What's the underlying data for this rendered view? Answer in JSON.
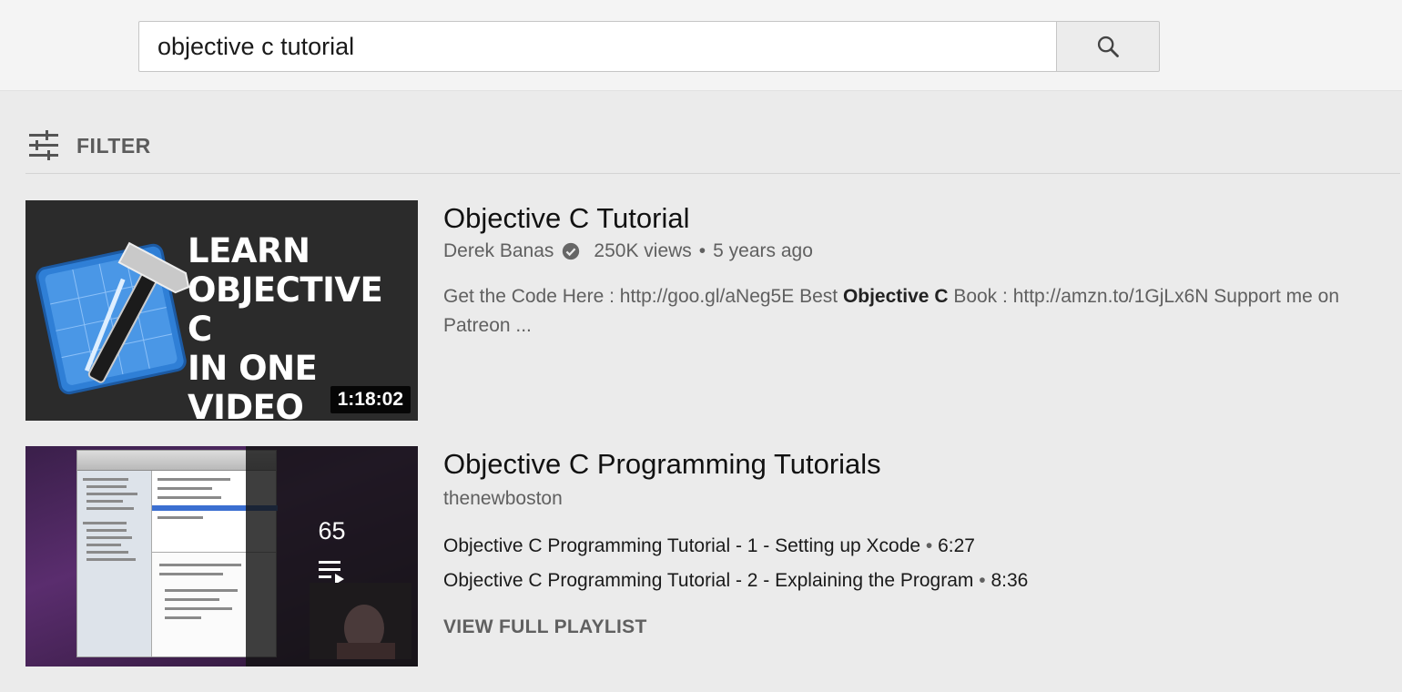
{
  "search": {
    "query": "objective c tutorial",
    "button_icon": "search-icon"
  },
  "filter": {
    "label": "FILTER",
    "icon": "tune-icon"
  },
  "results": [
    {
      "type": "video",
      "thumbnail_text": [
        "LEARN",
        "OBJECTIVE C",
        "IN ONE",
        "VIDEO"
      ],
      "duration": "1:18:02",
      "title": "Objective C Tutorial",
      "channel": "Derek Banas",
      "verified": true,
      "views": "250K views",
      "age": "5 years ago",
      "description_parts": {
        "before": "Get the Code Here : http://goo.gl/aNeg5E Best ",
        "bold": "Objective C",
        "after": " Book : http://amzn.to/1GjLx6N Support me on Patreon ..."
      }
    },
    {
      "type": "playlist",
      "video_count": "65",
      "title": "Objective C Programming Tutorials",
      "channel": "thenewboston",
      "items": [
        {
          "title": "Objective C Programming Tutorial - 1 - Setting up Xcode",
          "duration": "6:27"
        },
        {
          "title": "Objective C Programming Tutorial - 2 - Explaining the Program",
          "duration": "8:36"
        }
      ],
      "view_full_label": "VIEW FULL PLAYLIST"
    }
  ],
  "colors": {
    "page_bg": "#ebebeb",
    "secondary_text": "#606060",
    "title_text": "#111111"
  }
}
